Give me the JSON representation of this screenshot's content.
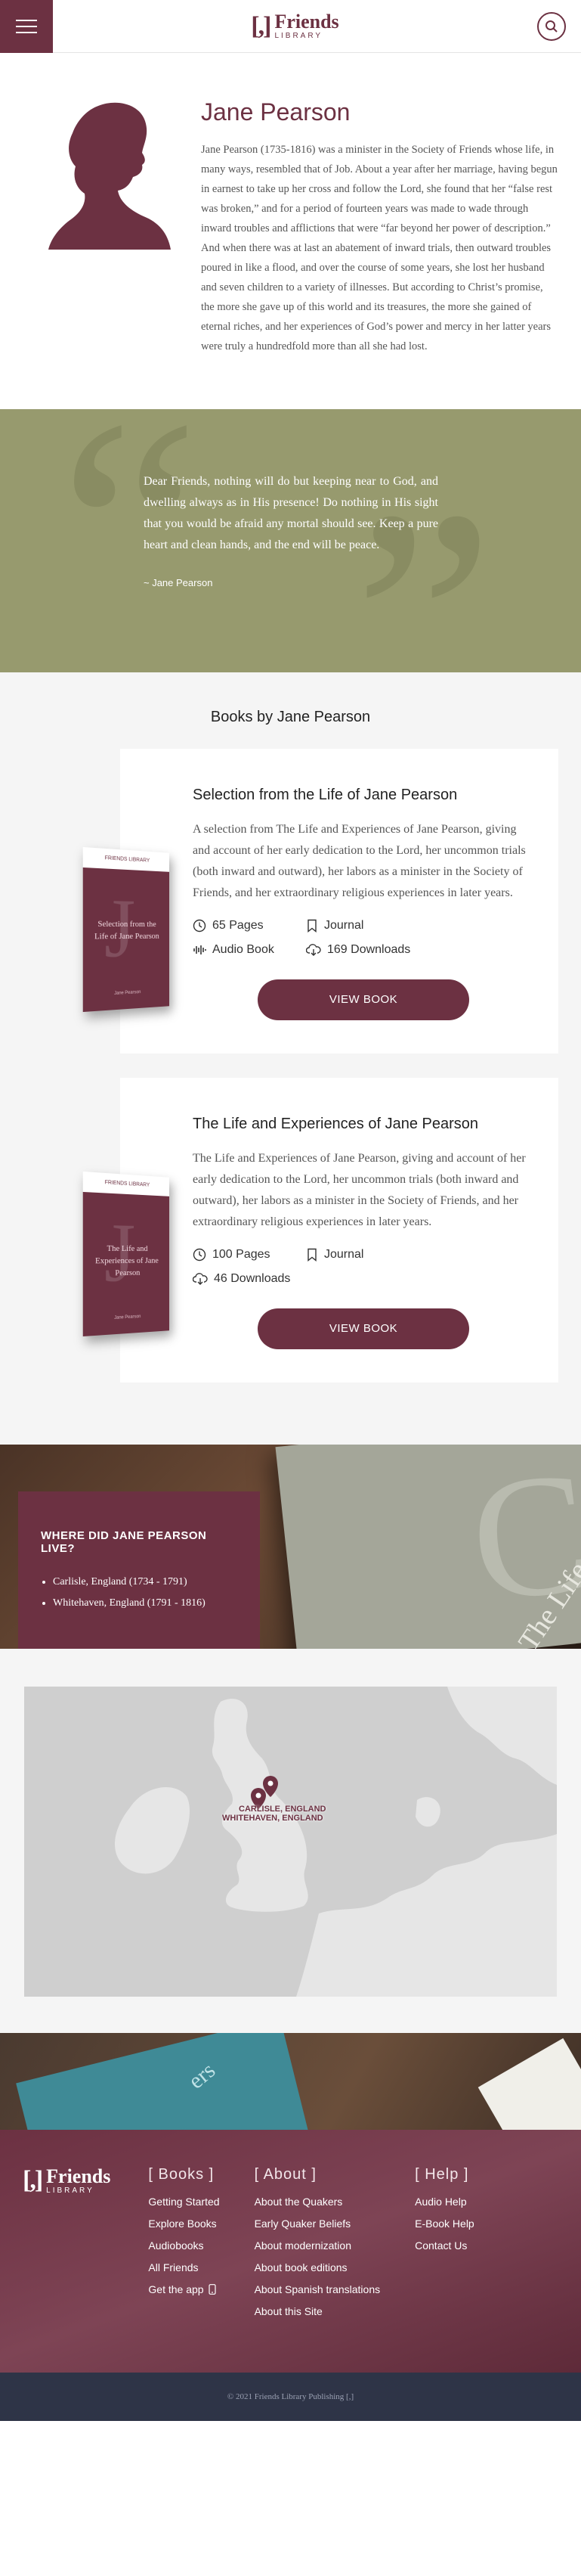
{
  "header": {
    "logo_bracket": "[,]",
    "logo_name": "Friends",
    "logo_sub": "LIBRARY"
  },
  "bio": {
    "name": "Jane Pearson",
    "text": "Jane Pearson (1735-1816) was a minister in the Society of Friends whose life, in many ways, resembled that of Job. About a year after her marriage, having begun in earnest to take up her cross and follow the Lord, she found that her “false rest was broken,” and for a period of fourteen years was made to wade through inward troubles and afflictions that were “far beyond her power of description.” And when there was at last an abatement of inward trials, then outward troubles poured in like a flood, and over the course of some years, she lost her husband and seven children to a variety of illnesses. But according to Christ’s promise, the more she gave up of this world and its treasures, the more she gained of eternal riches, and her experiences of God’s power and mercy in her latter years were truly a hundredfold more than all she had lost."
  },
  "quote": {
    "text": "Dear Friends, nothing will do but keeping near to God, and dwelling always as in His presence! Do nothing in His sight that you would be afraid any mortal should see. Keep a pure heart and clean hands, and the end will be peace.",
    "cite": "~ Jane Pearson"
  },
  "books": {
    "heading": "Books by Jane Pearson",
    "items": [
      {
        "title": "Selection from the Life of Jane Pearson",
        "description": "A selection from The Life and Experiences of Jane Pearson, giving and account of her early dedication to the Lord, her uncommon trials (both inward and outward), her labors as a minister in the Society of Friends, and her extraordinary religious experiences in later years.",
        "pages": "65 Pages",
        "type": "Journal",
        "audio": "Audio Book",
        "downloads": "169 Downloads",
        "cover_title": "Selection from the Life of Jane Pearson",
        "cover_author": "Jane Pearson",
        "cover_top": "FRIENDS LIBRARY",
        "button": "VIEW BOOK"
      },
      {
        "title": "The Life and Experiences of Jane Pearson",
        "description": "The Life and Experiences of Jane Pearson, giving and account of her early dedication to the Lord, her uncommon trials (both inward and outward), her labors as a minister in the Society of Friends, and her extraordinary religious experiences in later years.",
        "pages": "100 Pages",
        "type": "Journal",
        "downloads": "46 Downloads",
        "cover_title": "The Life and Experiences of Jane Pearson",
        "cover_author": "Jane Pearson",
        "cover_top": "FRIENDS LIBRARY",
        "button": "VIEW BOOK"
      }
    ]
  },
  "where": {
    "heading": "WHERE DID JANE PEARSON LIVE?",
    "places": [
      "Carlisle, England (1734 - 1791)",
      "Whitehaven, England (1791 - 1816)"
    ],
    "book_text": "The Life"
  },
  "map": {
    "label_1": "CARLISLE, ENGLAND",
    "label_2": "WHITEHAVEN, ENGLAND"
  },
  "footer": {
    "books_heading": "[ Books ]",
    "books_links": [
      "Getting Started",
      "Explore Books",
      "Audiobooks",
      "All Friends",
      "Get the app"
    ],
    "about_heading": "[ About ]",
    "about_links": [
      "About the Quakers",
      "Early Quaker Beliefs",
      "About modernization",
      "About book editions",
      "About Spanish translations",
      "About this Site"
    ],
    "help_heading": "[ Help ]",
    "help_links": [
      "Audio Help",
      "E-Book Help",
      "Contact Us"
    ],
    "copyright": "© 2021 Friends Library Publishing [,]"
  },
  "colors": {
    "brand": "#6c3142",
    "quote_bg": "#979a6e",
    "footer_bottom": "#2e3447"
  }
}
